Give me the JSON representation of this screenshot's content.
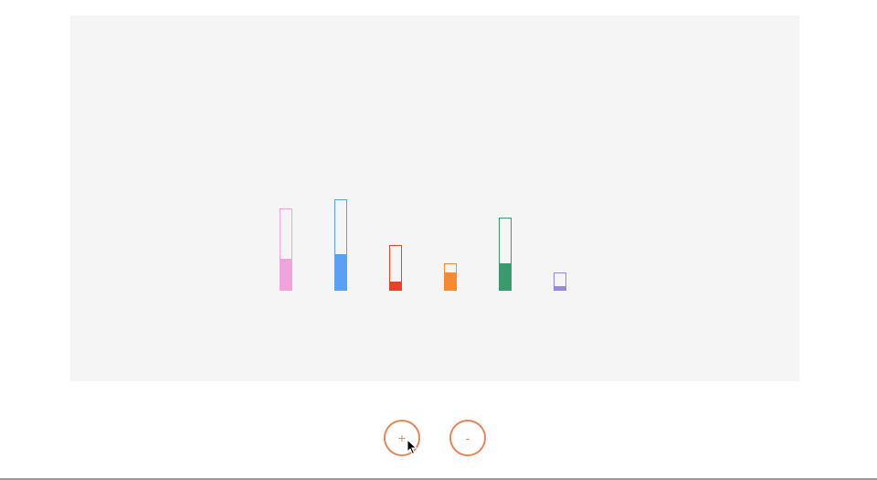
{
  "controls": {
    "increase_label": "+",
    "decrease_label": "-"
  },
  "accent_color": "#e8845a",
  "stage_color": "#f5f5f5",
  "cylinders": [
    {
      "name": "pink",
      "color": "#f0a4dc",
      "capacity": 9,
      "level": 3.5
    },
    {
      "name": "blue",
      "color": "#5aa0f5",
      "capacity": 10,
      "level": 4
    },
    {
      "name": "red",
      "color": "#e0442a",
      "capacity": 5,
      "level": 1
    },
    {
      "name": "orange",
      "color": "#f58a30",
      "capacity": 3,
      "level": 2
    },
    {
      "name": "green",
      "color": "#3a9a6e",
      "capacity": 8,
      "level": 3
    },
    {
      "name": "purple",
      "color": "#9a86e8",
      "capacity": 2,
      "level": 0.5
    }
  ]
}
